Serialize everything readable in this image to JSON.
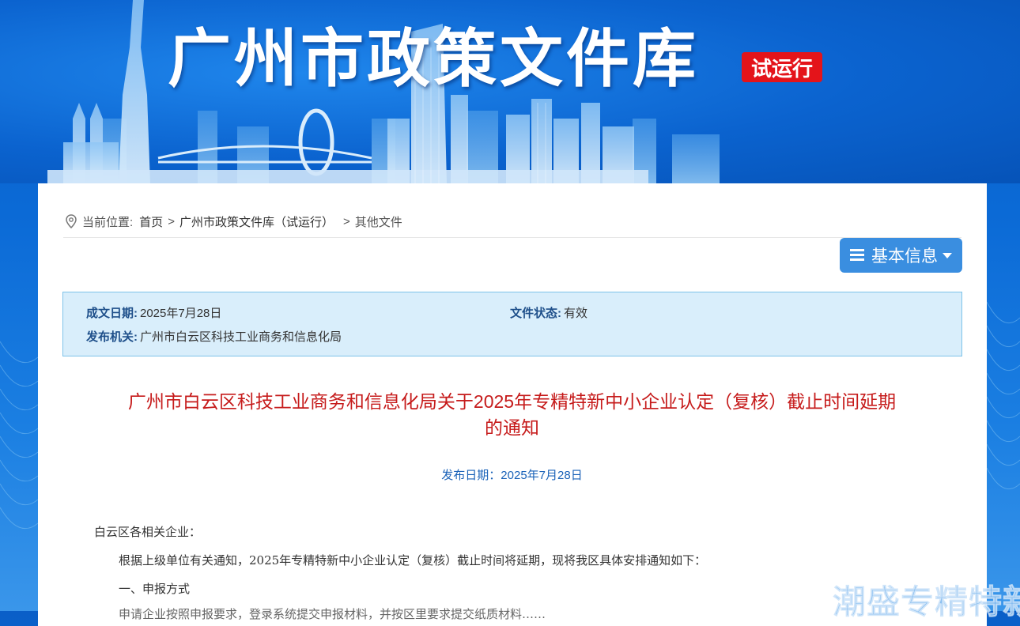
{
  "header": {
    "site_title": "广州市政策文件库",
    "trial_badge": "试运行"
  },
  "breadcrumb": {
    "prefix": "当前位置:",
    "items": [
      "首页",
      "广州市政策文件库（试运行）",
      "其他文件"
    ],
    "separator": ">"
  },
  "info_toggle": {
    "label": "基本信息",
    "icon": "menu-icon"
  },
  "basic_info": {
    "date_label": "成文日期:",
    "date_value": "2025年7月28日",
    "status_label": "文件状态:",
    "status_value": "有效",
    "issuer_label": "发布机关:",
    "issuer_value": "广州市白云区科技工业商务和信息化局"
  },
  "document": {
    "title_line1": "广州市白云区科技工业商务和信息化局关于2025年专精特新中小企业认定（复核）截止时间延期",
    "title_line2": "的通知",
    "publish_date": "发布日期：2025年7月28日",
    "salutation": "白云区各相关企业：",
    "para1": "根据上级单位有关通知，2025年专精特新中小企业认定（复核）截止时间将延期，现将我区具体安排通知如下：",
    "section1": "一、申报方式",
    "para2_partial": "申请企业按照申报要求，登录系统提交申报材料，并按区里要求提交纸质材料……"
  },
  "watermark": "潮盛专精特新",
  "colors": {
    "title_red": "#c61b1b",
    "label_blue": "#1e4f8a",
    "button_blue": "#3a8ee0",
    "badge_red": "#e4141a"
  }
}
